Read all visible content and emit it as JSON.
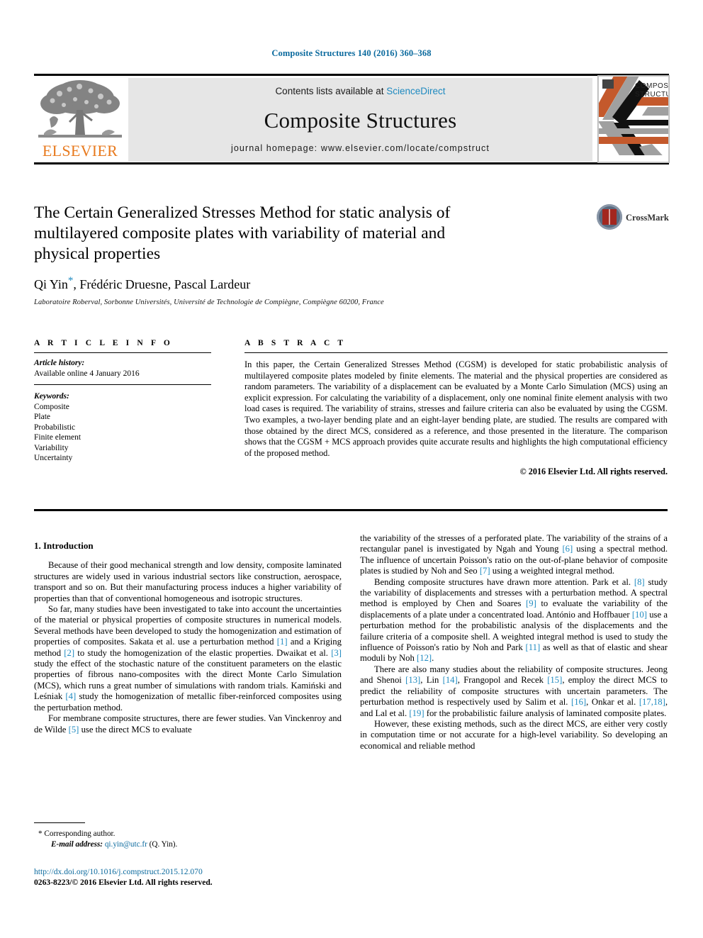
{
  "running_head": "Composite Structures 140 (2016) 360–368",
  "masthead": {
    "contents_prefix": "Contents lists available at ",
    "sciencedirect": "ScienceDirect",
    "journal_title": "Composite Structures",
    "homepage": "journal homepage: www.elsevier.com/locate/compstruct",
    "publisher_wordmark": "ELSEVIER",
    "cover_title_line1": "COMPOSITE",
    "cover_title_line2": "STRUCTURES"
  },
  "crossmark": {
    "label": "CrossMark"
  },
  "article": {
    "title": "The Certain Generalized Stresses Method for static analysis of multilayered composite plates with variability of material and physical properties",
    "authors_pre": "Qi Yin",
    "corresponding_marker": "*",
    "authors_post": ", Frédéric Druesne, Pascal Lardeur",
    "affiliation": "Laboratoire Roberval, Sorbonne Universités, Université de Technologie de Compiègne, Compiègne 60200, France"
  },
  "article_info": {
    "heading": "A R T I C L E   I N F O",
    "history_label": "Article history:",
    "history_value": "Available online 4 January 2016",
    "keywords_label": "Keywords:",
    "keywords": [
      "Composite",
      "Plate",
      "Probabilistic",
      "Finite element",
      "Variability",
      "Uncertainty"
    ]
  },
  "abstract": {
    "heading": "A B S T R A C T",
    "text": "In this paper, the Certain Generalized Stresses Method (CGSM) is developed for static probabilistic analysis of multilayered composite plates modeled by finite elements. The material and the physical properties are considered as random parameters. The variability of a displacement can be evaluated by a Monte Carlo Simulation (MCS) using an explicit expression. For calculating the variability of a displacement, only one nominal finite element analysis with two load cases is required. The variability of strains, stresses and failure criteria can also be evaluated by using the CGSM. Two examples, a two-layer bending plate and an eight-layer bending plate, are studied. The results are compared with those obtained by the direct MCS, considered as a reference, and those presented in the literature. The comparison shows that the CGSM + MCS approach provides quite accurate results and highlights the high computational efficiency of the proposed method.",
    "copyright": "© 2016 Elsevier Ltd. All rights reserved."
  },
  "body": {
    "section_heading": "1. Introduction",
    "left_paragraphs": [
      "Because of their good mechanical strength and low density, composite laminated structures are widely used in various industrial sectors like construction, aerospace, transport and so on. But their manufacturing process induces a higher variability of properties than that of conventional homogeneous and isotropic structures.",
      "So far, many studies have been investigated to take into account the uncertainties of the material or physical properties of composite structures in numerical models. Several methods have been developed to study the homogenization and estimation of properties of composites. Sakata et al. use a perturbation method [1] and a Kriging method [2] to study the homogenization of the elastic properties. Dwaikat et al. [3] study the effect of the stochastic nature of the constituent parameters on the elastic properties of fibrous nano-composites with the direct Monte Carlo Simulation (MCS), which runs a great number of simulations with random trials. Kamiński and Leśniak [4] study the homogenization of metallic fiber-reinforced composites using the perturbation method.",
      "For membrane composite structures, there are fewer studies. Van Vinckenroy and de Wilde [5] use the direct MCS to evaluate"
    ],
    "right_paragraphs": [
      "the variability of the stresses of a perforated plate. The variability of the strains of a rectangular panel is investigated by Ngah and Young [6] using a spectral method. The influence of uncertain Poisson's ratio on the out-of-plane behavior of composite plates is studied by Noh and Seo [7] using a weighted integral method.",
      "Bending composite structures have drawn more attention. Park et al. [8] study the variability of displacements and stresses with a perturbation method. A spectral method is employed by Chen and Soares [9] to evaluate the variability of the displacements of a plate under a concentrated load. António and Hoffbauer [10] use a perturbation method for the probabilistic analysis of the displacements and the failure criteria of a composite shell. A weighted integral method is used to study the influence of Poisson's ratio by Noh and Park [11] as well as that of elastic and shear moduli by Noh [12].",
      "There are also many studies about the reliability of composite structures. Jeong and Shenoi [13], Lin [14], Frangopol and Recek [15], employ the direct MCS to predict the reliability of composite structures with uncertain parameters. The perturbation method is respectively used by Salim et al. [16], Onkar et al. [17,18], and Lal et al. [19] for the probabilistic failure analysis of laminated composite plates.",
      "However, these existing methods, such as the direct MCS, are either very costly in computation time or not accurate for a high-level variability. So developing an economical and reliable method"
    ]
  },
  "footnote": {
    "marker": "*",
    "corresponding": "Corresponding author.",
    "email_label": "E-mail address:",
    "email": "qi.yin@utc.fr",
    "email_owner": "(Q. Yin)."
  },
  "footer": {
    "doi": "http://dx.doi.org/10.1016/j.compstruct.2015.12.070",
    "issn_line": "0263-8223/© 2016 Elsevier Ltd. All rights reserved."
  },
  "colors": {
    "link_blue": "#1f8ac0",
    "head_blue": "#0b6a9e",
    "elsevier_orange": "#e87a1e",
    "band_grey": "#e6e6e6"
  }
}
